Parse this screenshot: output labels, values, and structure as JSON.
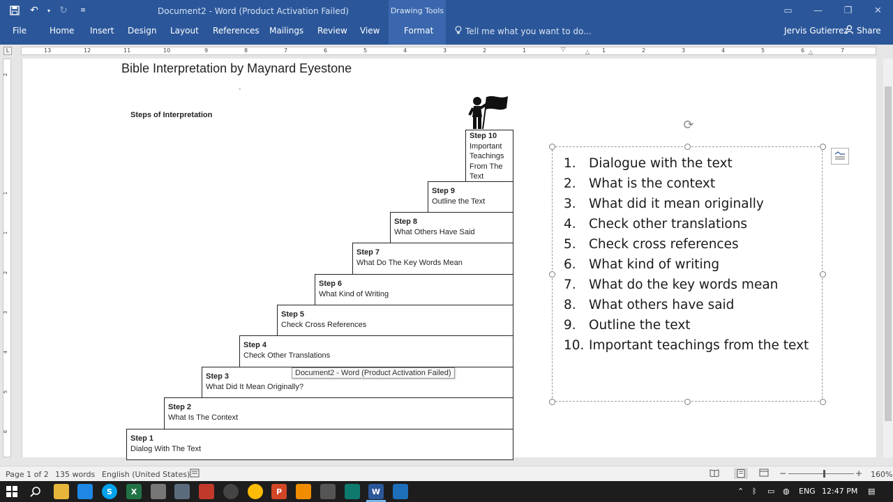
{
  "window": {
    "title": "Document2 - Word (Product Activation Failed)",
    "context_group": "Drawing Tools"
  },
  "ribbon": {
    "tabs": [
      "File",
      "Home",
      "Insert",
      "Design",
      "Layout",
      "References",
      "Mailings",
      "Review",
      "View",
      "Format"
    ],
    "tell_me": "Tell me what you want to do...",
    "user": "Jervis Gutierrez",
    "share": "Share"
  },
  "ruler": {
    "labels": [
      "13",
      "12",
      "11",
      "10",
      "9",
      "8",
      "7",
      "6",
      "5",
      "4",
      "3",
      "2",
      "1",
      "1",
      "2",
      "3",
      "4",
      "5",
      "6",
      "7"
    ]
  },
  "vruler": {
    "labels": [
      "2",
      "1",
      "1",
      "2",
      "3",
      "4",
      "5",
      "6",
      "7"
    ]
  },
  "document": {
    "title": "Bible Interpretation by Maynard Eyestone",
    "steps_heading": "Steps of Interpretation",
    "steps": [
      {
        "title": "Step 1",
        "text": "Dialog With The Text"
      },
      {
        "title": "Step 2",
        "text": "What Is The Context"
      },
      {
        "title": "Step 3",
        "text": "What Did It Mean Originally?"
      },
      {
        "title": "Step 4",
        "text": "Check Other Translations"
      },
      {
        "title": "Step 5",
        "text": "Check Cross References"
      },
      {
        "title": "Step 6",
        "text": "What Kind of Writing"
      },
      {
        "title": "Step 7",
        "text": "What Do The Key Words Mean"
      },
      {
        "title": "Step 8",
        "text": "What Others Have Said"
      },
      {
        "title": "Step 9",
        "text": "Outline the Text"
      },
      {
        "title": "Step 10",
        "text": "Important Teachings From The Text"
      }
    ],
    "list": [
      {
        "num": "1.",
        "text": "Dialogue with the text"
      },
      {
        "num": "2.",
        "text": "What is the context"
      },
      {
        "num": "3.",
        "text": "What did it mean originally"
      },
      {
        "num": "4.",
        "text": "Check other translations"
      },
      {
        "num": "5.",
        "text": "Check cross references"
      },
      {
        "num": "6.",
        "text": "What kind of writing"
      },
      {
        "num": "7.",
        "text": "What do the key words mean"
      },
      {
        "num": "8.",
        "text": "What others have said"
      },
      {
        "num": "9.",
        "text": "Outline the text"
      },
      {
        "num": "10.",
        "text": "Important teachings from the text"
      }
    ],
    "tooltip": "Document2 - Word (Product Activation Failed)"
  },
  "status": {
    "page": "Page 1 of 2",
    "words": "135 words",
    "language": "English (United States)",
    "zoom_minus": "−",
    "zoom_plus": "+",
    "zoom": "160%"
  },
  "taskbar": {
    "lang": "ENG",
    "time": "12:47 PM"
  },
  "colors": {
    "ribbon": "#2b579a",
    "context_tab": "#3a67ad",
    "taskbar": "#1d1d1d"
  }
}
